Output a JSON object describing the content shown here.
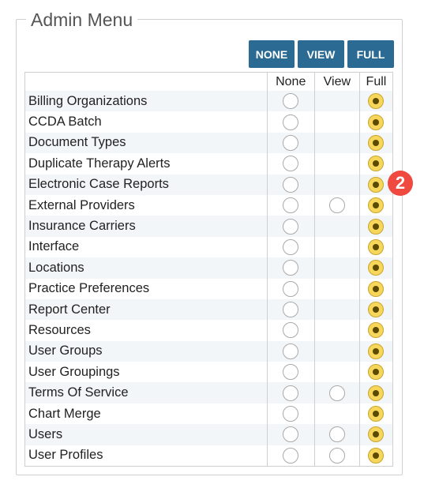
{
  "panel": {
    "title": "Admin Menu"
  },
  "buttons": {
    "none": "NONE",
    "view": "VIEW",
    "full": "FULL"
  },
  "columns": {
    "none": "None",
    "view": "View",
    "full": "Full"
  },
  "rows": [
    {
      "label": "Billing Organizations",
      "view_available": false,
      "selected": "full"
    },
    {
      "label": "CCDA Batch",
      "view_available": false,
      "selected": "full"
    },
    {
      "label": "Document Types",
      "view_available": false,
      "selected": "full"
    },
    {
      "label": "Duplicate Therapy Alerts",
      "view_available": false,
      "selected": "full"
    },
    {
      "label": "Electronic Case Reports",
      "view_available": false,
      "selected": "full"
    },
    {
      "label": "External Providers",
      "view_available": true,
      "selected": "full"
    },
    {
      "label": "Insurance Carriers",
      "view_available": false,
      "selected": "full"
    },
    {
      "label": "Interface",
      "view_available": false,
      "selected": "full"
    },
    {
      "label": "Locations",
      "view_available": false,
      "selected": "full"
    },
    {
      "label": "Practice Preferences",
      "view_available": false,
      "selected": "full"
    },
    {
      "label": "Report Center",
      "view_available": false,
      "selected": "full"
    },
    {
      "label": "Resources",
      "view_available": false,
      "selected": "full"
    },
    {
      "label": "User Groups",
      "view_available": false,
      "selected": "full"
    },
    {
      "label": "User Groupings",
      "view_available": false,
      "selected": "full"
    },
    {
      "label": "Terms Of Service",
      "view_available": true,
      "selected": "full"
    },
    {
      "label": "Chart Merge",
      "view_available": false,
      "selected": "full"
    },
    {
      "label": "Users",
      "view_available": true,
      "selected": "full"
    },
    {
      "label": "User Profiles",
      "view_available": true,
      "selected": "full"
    }
  ],
  "annotation": {
    "badge": "2"
  },
  "colors": {
    "button": "#2b6a93",
    "checked": "#f7d65c",
    "badge": "#f0493f"
  }
}
